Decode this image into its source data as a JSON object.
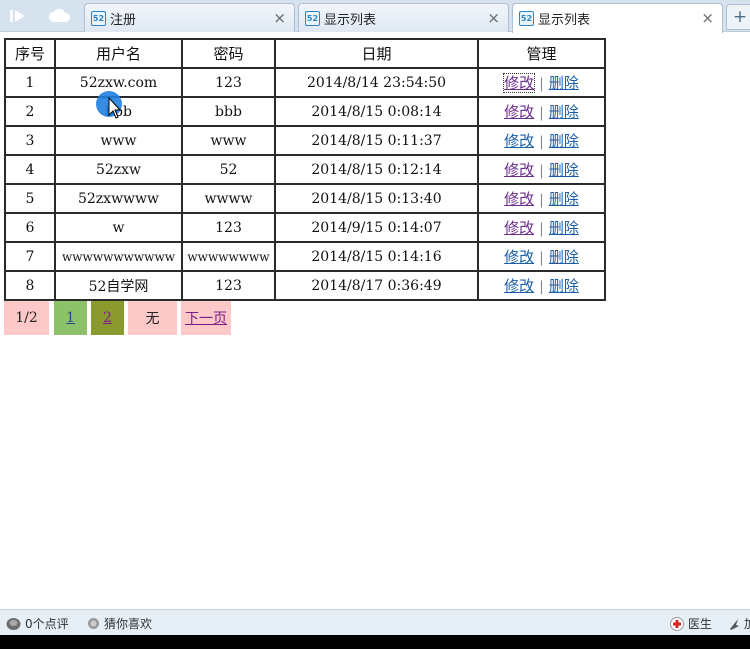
{
  "tabs": [
    {
      "title": "注册",
      "close": "×"
    },
    {
      "title": "显示列表",
      "close": "×"
    },
    {
      "title": "显示列表",
      "close": "×"
    }
  ],
  "new_tab": "+",
  "table": {
    "headers": [
      "序号",
      "用户名",
      "密码",
      "日期",
      "管理"
    ],
    "rows": [
      {
        "id": "1",
        "user": "52zxw.com",
        "pwd": "123",
        "date": "2014/8/14 23:54:50"
      },
      {
        "id": "2",
        "user": "bbb",
        "pwd": "bbb",
        "date": "2014/8/15 0:08:14"
      },
      {
        "id": "3",
        "user": "www",
        "pwd": "www",
        "date": "2014/8/15 0:11:37"
      },
      {
        "id": "4",
        "user": "52zxw",
        "pwd": "52",
        "date": "2014/8/15 0:12:14"
      },
      {
        "id": "5",
        "user": "52zxwwww",
        "pwd": "wwww",
        "date": "2014/8/15 0:13:40"
      },
      {
        "id": "6",
        "user": "w",
        "pwd": "123",
        "date": "2014/9/15 0:14:07"
      },
      {
        "id": "7",
        "user": "wwwwwwwwwww",
        "pwd": "wwwwwwww",
        "date": "2014/8/15 0:14:16"
      },
      {
        "id": "8",
        "user": "52自学网",
        "pwd": "123",
        "date": "2014/8/17 0:36:49"
      }
    ],
    "edit_label": "修改",
    "separator": "|",
    "delete_label": "删除"
  },
  "pager": {
    "info": "1/2",
    "page1": "1",
    "page2": "2",
    "prev": "无",
    "next": "下一页"
  },
  "statusbar": {
    "comments": "0个点评",
    "guess": "猜你喜欢",
    "doctor": "医生",
    "accelerate": "加"
  },
  "colors": {
    "visited_link": "#6a2e8c",
    "link": "#1a5ea8",
    "pager_pink": "#fcc8c8",
    "pager_green": "#8ec26a",
    "pager_olive": "#8b9a2f",
    "cursor_highlight": "#1e7fe0"
  }
}
